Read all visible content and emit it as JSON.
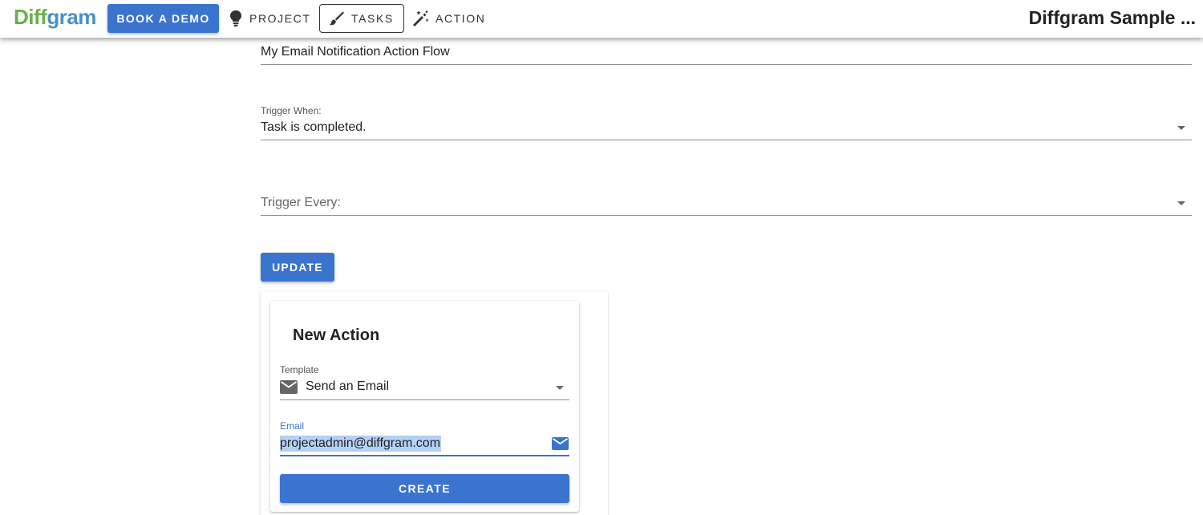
{
  "header": {
    "logo_part1": "Diff",
    "logo_part2": "gram",
    "book_demo_label": "BOOK A DEMO",
    "nav": {
      "project_label": "PROJECT",
      "tasks_label": "TASKS",
      "action_label": "ACTION"
    },
    "project_title": "Diffgram Sample ..."
  },
  "form": {
    "name_value": "My Email Notification Action Flow",
    "trigger_when": {
      "label": "Trigger When:",
      "value": "Task is completed."
    },
    "trigger_every": {
      "placeholder": "Trigger Every:"
    },
    "update_label": "UPDATE"
  },
  "new_action": {
    "title": "New Action",
    "template": {
      "label": "Template",
      "value": "Send an Email",
      "icon": "email-icon"
    },
    "email": {
      "label": "Email",
      "value": "projectadmin@diffgram.com",
      "icon": "email-icon"
    },
    "create_label": "CREATE"
  },
  "colors": {
    "primary": "#3b74cf",
    "logo_green": "#6ab04c",
    "logo_blue": "#4a90c8",
    "selection": "#b3d0f5"
  }
}
